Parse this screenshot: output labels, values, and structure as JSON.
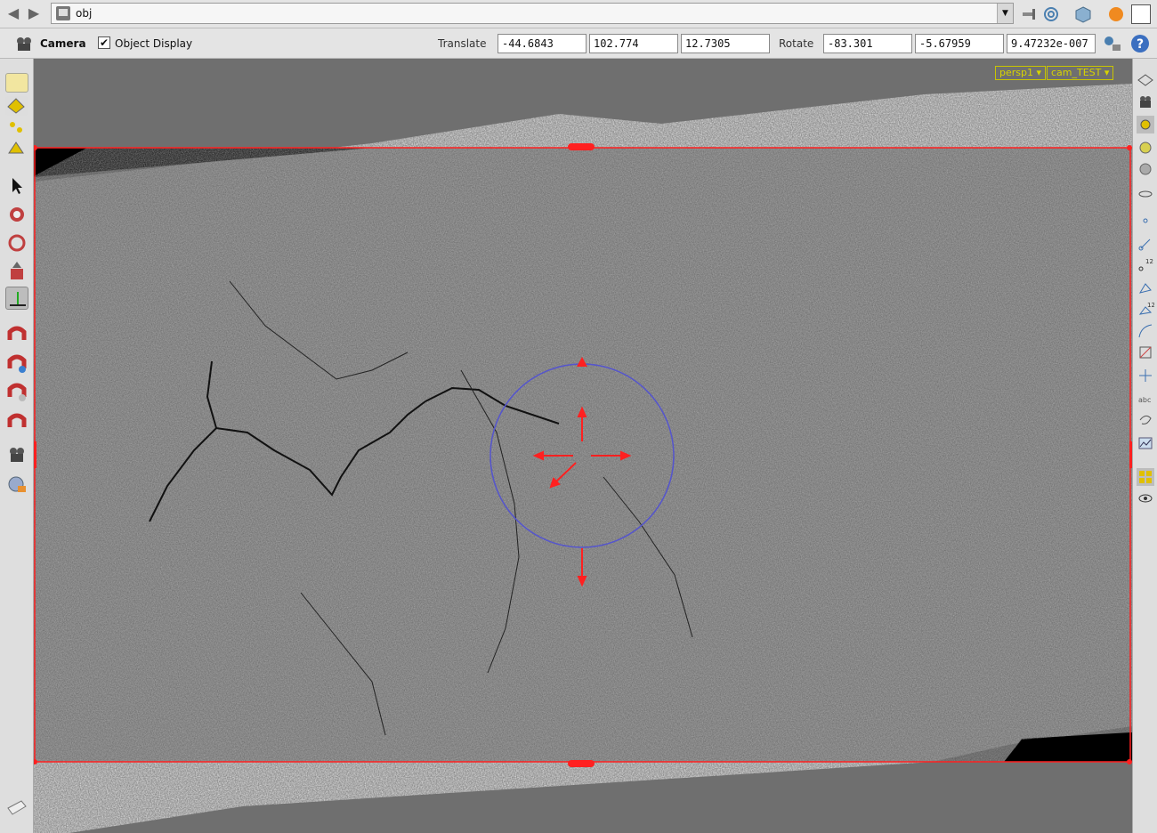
{
  "pathbar": {
    "path": "obj",
    "icons": [
      "back-arrow-icon",
      "forward-arrow-icon",
      "scene-icon",
      "pin-icon",
      "spiral-icon",
      "cube-icon",
      "sphere-icon",
      "viewport-icon"
    ]
  },
  "toolbar": {
    "camera_label": "Camera",
    "object_display_label": "Object Display",
    "object_display_checked": true,
    "translate_label": "Translate",
    "translate": [
      "-44.6843",
      "102.774",
      "12.7305"
    ],
    "rotate_label": "Rotate",
    "rotate": [
      "-83.301",
      "-5.67959",
      "9.47232e-007"
    ]
  },
  "viewport": {
    "view_menu": "persp1",
    "camera_menu": "cam_TEST"
  },
  "colors": {
    "accent_red": "#ff0000",
    "guide_tag": "#d8d400",
    "handle_ring": "#5555cc",
    "panel_bg": "#e4e4e4"
  }
}
